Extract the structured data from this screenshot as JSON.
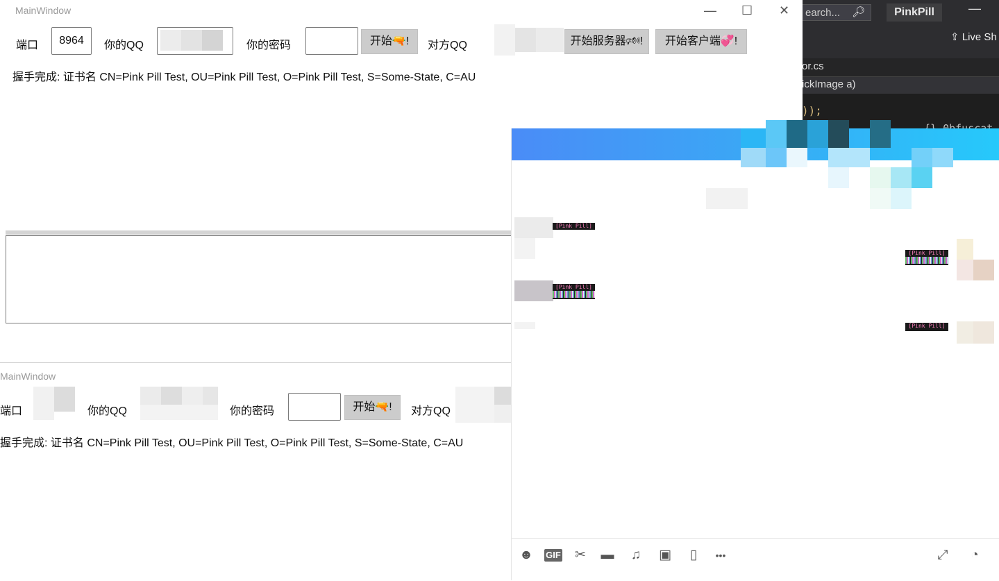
{
  "vs": {
    "search_text": "earch...",
    "search_icon": "search-icon",
    "project_name": "PinkPill",
    "minimize_glyph": "—",
    "live_share": "Live Sh",
    "tab_file": "or.cs",
    "nav_member": "ickImage a)",
    "code_line1": "));",
    "code_line2": "{} 0bfuscat"
  },
  "top_window": {
    "title": "MainWindow",
    "controls": {
      "minimize": "—",
      "maximize": "☐",
      "close": "✕"
    },
    "port_label": "端口",
    "port_value": "8964",
    "your_qq_label": "你的QQ",
    "password_label": "你的密码",
    "start_button": "开始🔫!",
    "peer_qq_label": "对方QQ",
    "start_server_button": "开始服务器🕬!",
    "start_client_button": "开始客户端💞!",
    "status": "握手完成: 证书名 CN=Pink Pill Test, OU=Pink Pill Test, O=Pink Pill Test, S=Some-State, C=AU"
  },
  "bottom_window": {
    "title": "MainWindow",
    "port_label": "端口",
    "your_qq_label": "你的QQ",
    "password_label": "你的密码",
    "start_button": "开始🔫!",
    "peer_qq_label": "对方QQ",
    "status": "握手完成: 证书名 CN=Pink Pill Test, OU=Pink Pill Test, O=Pink Pill Test, S=Some-State, C=AU"
  },
  "qq_chat": {
    "header_colors": [
      "#4a8cf7",
      "#26c9fb"
    ],
    "messages": [
      {
        "side": "left",
        "tag": "[Pink Pill]"
      },
      {
        "side": "right",
        "tag": "[Pink Pill]"
      },
      {
        "side": "left",
        "tag": "[Pink Pill]"
      },
      {
        "side": "right",
        "tag": "[Pink Pill]"
      }
    ],
    "toolbar_icons": [
      "emoji-icon",
      "gif-icon",
      "scissors-icon",
      "folder-icon",
      "music-icon",
      "image-icon",
      "shake-icon",
      "more-icon",
      "expand-icon",
      "history-icon"
    ],
    "toolbar_glyphs": {
      "emoji": "☻",
      "gif": "GIF",
      "scissors": "✂",
      "folder": "▬",
      "music": "♫",
      "image": "▣",
      "shake": "▯",
      "more": "•••",
      "expand": "⤢",
      "history": "◔"
    }
  }
}
